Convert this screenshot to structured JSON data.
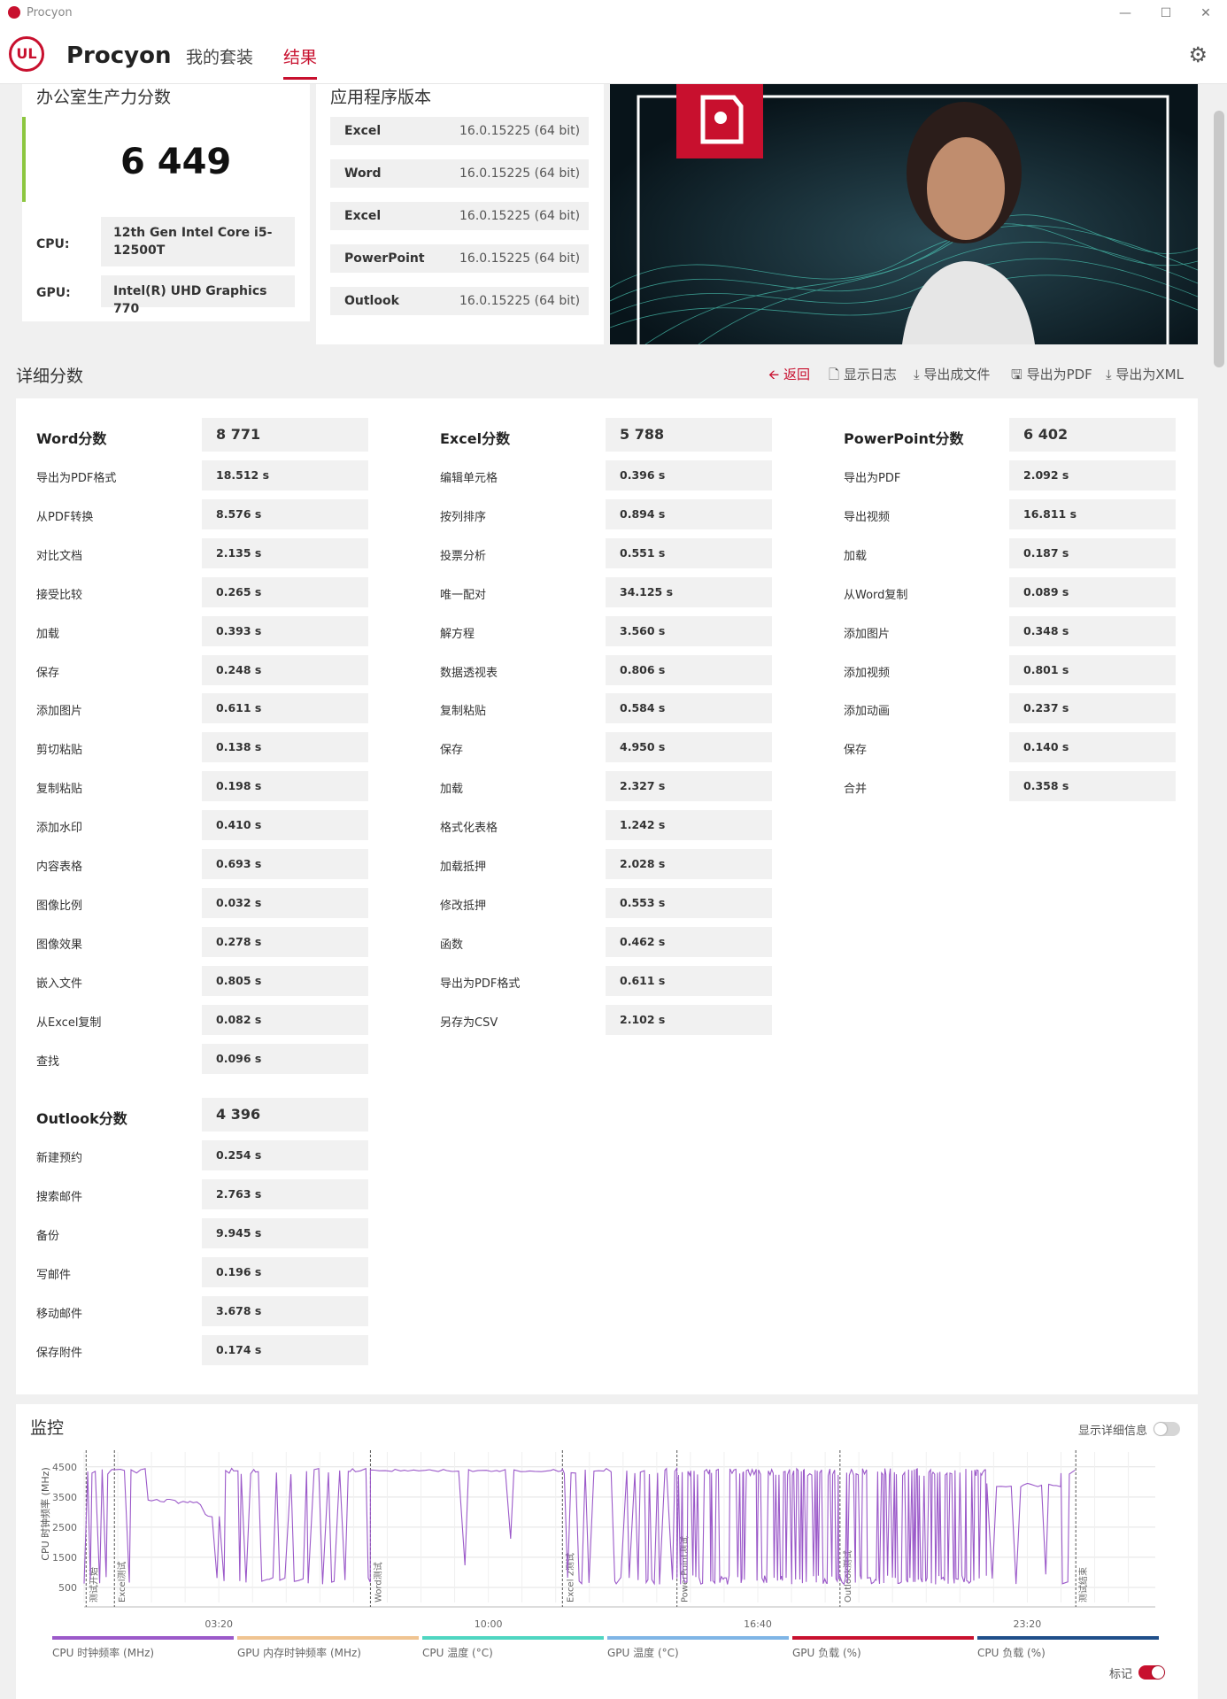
{
  "window": {
    "title": "Procyon",
    "minimize": "—",
    "maximize": "☐",
    "close": "✕"
  },
  "header": {
    "logo": "UL",
    "brand": "Procyon",
    "tabs": [
      "我的套装",
      "结果"
    ],
    "active_tab": 1
  },
  "summary": {
    "title": "办公室生产力分数",
    "score": "6 449",
    "cpu_label": "CPU:",
    "cpu_value": "12th Gen Intel Core i5-12500T",
    "gpu_label": "GPU:",
    "gpu_value": "Intel(R) UHD Graphics 770"
  },
  "versions": {
    "title": "应用程序版本",
    "rows": [
      {
        "name": "Excel",
        "value": "16.0.15225 (64 bit)"
      },
      {
        "name": "Word",
        "value": "16.0.15225 (64 bit)"
      },
      {
        "name": "Excel",
        "value": "16.0.15225 (64 bit)"
      },
      {
        "name": "PowerPoint",
        "value": "16.0.15225 (64 bit)"
      },
      {
        "name": "Outlook",
        "value": "16.0.15225 (64 bit)"
      }
    ]
  },
  "details": {
    "title": "详细分数",
    "toolbar": [
      "返回",
      "显示日志",
      "导出成文件",
      "导出为PDF",
      "导出为XML"
    ],
    "word": {
      "title": "Word分数",
      "score": "8 771",
      "rows": [
        [
          "导出为PDF格式",
          "18.512 s"
        ],
        [
          "从PDF转换",
          "8.576 s"
        ],
        [
          "对比文档",
          "2.135 s"
        ],
        [
          "接受比较",
          "0.265 s"
        ],
        [
          "加载",
          "0.393 s"
        ],
        [
          "保存",
          "0.248 s"
        ],
        [
          "添加图片",
          "0.611 s"
        ],
        [
          "剪切粘贴",
          "0.138 s"
        ],
        [
          "复制粘贴",
          "0.198 s"
        ],
        [
          "添加水印",
          "0.410 s"
        ],
        [
          "内容表格",
          "0.693 s"
        ],
        [
          "图像比例",
          "0.032 s"
        ],
        [
          "图像效果",
          "0.278 s"
        ],
        [
          "嵌入文件",
          "0.805 s"
        ],
        [
          "从Excel复制",
          "0.082 s"
        ],
        [
          "查找",
          "0.096 s"
        ]
      ]
    },
    "excel": {
      "title": "Excel分数",
      "score": "5 788",
      "rows": [
        [
          "编辑单元格",
          "0.396 s"
        ],
        [
          "按列排序",
          "0.894 s"
        ],
        [
          "投票分析",
          "0.551 s"
        ],
        [
          "唯一配对",
          "34.125 s"
        ],
        [
          "解方程",
          "3.560 s"
        ],
        [
          "数据透视表",
          "0.806 s"
        ],
        [
          "复制粘贴",
          "0.584 s"
        ],
        [
          "保存",
          "4.950 s"
        ],
        [
          "加载",
          "2.327 s"
        ],
        [
          "格式化表格",
          "1.242 s"
        ],
        [
          "加载抵押",
          "2.028 s"
        ],
        [
          "修改抵押",
          "0.553 s"
        ],
        [
          "函数",
          "0.462 s"
        ],
        [
          "导出为PDF格式",
          "0.611 s"
        ],
        [
          "另存为CSV",
          "2.102 s"
        ]
      ]
    },
    "powerpoint": {
      "title": "PowerPoint分数",
      "score": "6 402",
      "rows": [
        [
          "导出为PDF",
          "2.092 s"
        ],
        [
          "导出视频",
          "16.811 s"
        ],
        [
          "加载",
          "0.187 s"
        ],
        [
          "从Word复制",
          "0.089 s"
        ],
        [
          "添加图片",
          "0.348 s"
        ],
        [
          "添加视频",
          "0.801 s"
        ],
        [
          "添加动画",
          "0.237 s"
        ],
        [
          "保存",
          "0.140 s"
        ],
        [
          "合并",
          "0.358 s"
        ]
      ]
    },
    "outlook": {
      "title": "Outlook分数",
      "score": "4 396",
      "rows": [
        [
          "新建预约",
          "0.254 s"
        ],
        [
          "搜索邮件",
          "2.763 s"
        ],
        [
          "备份",
          "9.945 s"
        ],
        [
          "写邮件",
          "0.196 s"
        ],
        [
          "移动邮件",
          "3.678 s"
        ],
        [
          "保存附件",
          "0.174 s"
        ]
      ]
    }
  },
  "monitor": {
    "title": "监控",
    "show_details": "显示详细信息",
    "show_details_on": false,
    "marker_label": "标记",
    "marker_on": true,
    "chart_data": {
      "type": "line",
      "ylabel": "CPU 时钟频率 (MHz)",
      "yticks": [
        500,
        1500,
        2500,
        3500,
        4500
      ],
      "ylim": [
        0,
        4700
      ],
      "xticks": [
        "03:20",
        "10:00",
        "16:40",
        "23:20"
      ],
      "xtick_seconds": [
        200,
        600,
        1000,
        1400
      ],
      "xlim": [
        0,
        1590
      ],
      "markers": [
        {
          "label": "测试开始",
          "t": 3
        },
        {
          "label": "Excel测试",
          "t": 45
        },
        {
          "label": "Word测试",
          "t": 425
        },
        {
          "label": "Excel 2测试",
          "t": 710
        },
        {
          "label": "PowerPoint测试",
          "t": 880
        },
        {
          "label": "Outlook测试",
          "t": 1122
        },
        {
          "label": "测试结束",
          "t": 1472
        }
      ],
      "series_color": "#9b59c9",
      "series": [
        {
          "name": "CPU 时钟频率 (MHz)",
          "segments": [
            {
              "t0": 0,
              "t1": 45,
              "mode": "flip"
            },
            {
              "t0": 45,
              "t1": 95,
              "mode": "flip"
            },
            {
              "t0": 95,
              "t1": 140,
              "mode": "level",
              "v": 3380
            },
            {
              "t0": 140,
              "t1": 180,
              "mode": "level",
              "v": 3300
            },
            {
              "t0": 180,
              "t1": 210,
              "mode": "level",
              "v": 2900
            },
            {
              "t0": 210,
              "t1": 425,
              "mode": "flip"
            },
            {
              "t0": 425,
              "t1": 710,
              "mode": "flat",
              "v": 4380
            },
            {
              "t0": 710,
              "t1": 880,
              "mode": "flip"
            },
            {
              "t0": 880,
              "t1": 1122,
              "mode": "dense"
            },
            {
              "t0": 1122,
              "t1": 1340,
              "mode": "dense"
            },
            {
              "t0": 1340,
              "t1": 1450,
              "mode": "level",
              "v": 3900
            },
            {
              "t0": 1450,
              "t1": 1472,
              "mode": "flip"
            },
            {
              "t0": 1472,
              "t1": 1590,
              "mode": "none"
            }
          ]
        }
      ]
    },
    "legend": [
      {
        "label": "CPU 时钟频率 (MHz)",
        "color": "#9b59c9"
      },
      {
        "label": "GPU 内存时钟频率 (MHz)",
        "color": "#f0c491"
      },
      {
        "label": "CPU 温度 (°C)",
        "color": "#4fd6c1"
      },
      {
        "label": "GPU 温度 (°C)",
        "color": "#7fb5e6"
      },
      {
        "label": "GPU 负载 (%)",
        "color": "#c8102e"
      },
      {
        "label": "CPU 负载 (%)",
        "color": "#1f4f8a"
      }
    ]
  }
}
